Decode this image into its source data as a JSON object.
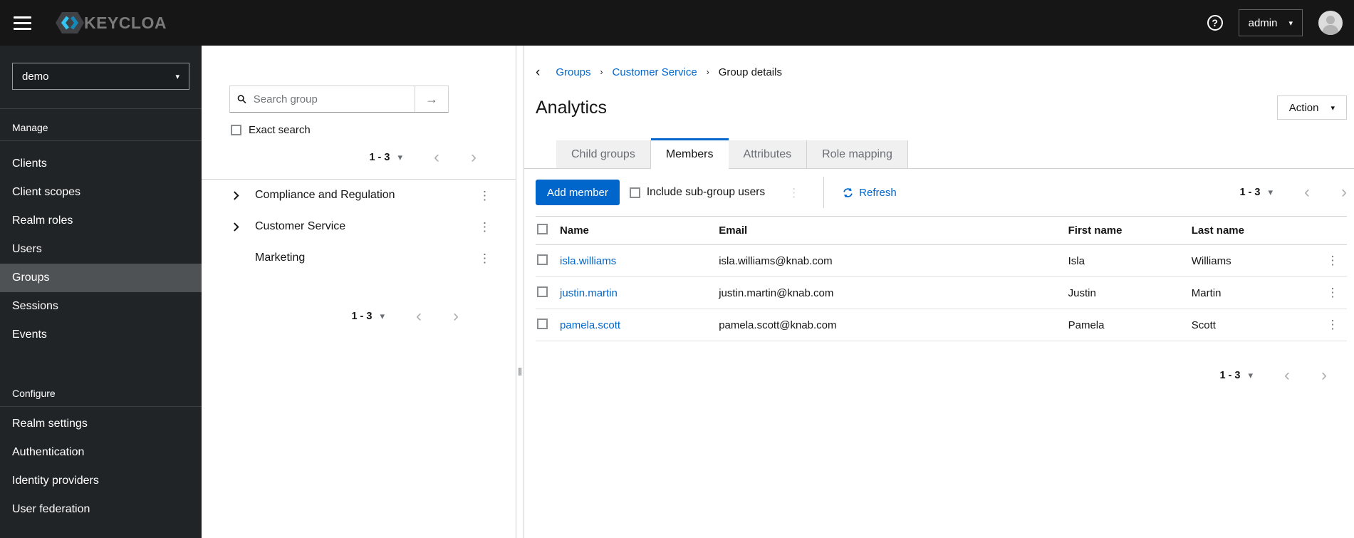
{
  "colors": {
    "accent_blue": "#0066cc",
    "topbar_bg": "#161616",
    "sidebar_bg": "#212427",
    "sidebar_selected_bg": "#4f5255",
    "tab_inactive_bg": "#f0f0f0",
    "link": "#0066cc",
    "logo_cyan": "#33c6f4"
  },
  "glyphs": {
    "caret_down": "▾",
    "chevron_left": "‹",
    "chevron_right": "›",
    "kebab": "⋮",
    "breadcrumb_separator": "›",
    "back_chevron": "‹",
    "search_submit_arrow": "→",
    "help_question": "?",
    "splitter_grip": "‖"
  },
  "topbar": {
    "brand": "KEYCLOAK",
    "username": "admin"
  },
  "sidebar": {
    "realm": "demo",
    "manage": {
      "label": "Manage",
      "items": [
        "Clients",
        "Client scopes",
        "Realm roles",
        "Users",
        "Groups",
        "Sessions",
        "Events"
      ]
    },
    "configure": {
      "label": "Configure",
      "items": [
        "Realm settings",
        "Authentication",
        "Identity providers",
        "User federation"
      ]
    },
    "active_item": "Groups"
  },
  "groups_panel": {
    "search_placeholder": "Search group",
    "exact_search": "Exact search",
    "pager_top": "1 - 3",
    "pager_bottom": "1 - 3",
    "tree": [
      {
        "label": "Compliance and Regulation",
        "expandable": true
      },
      {
        "label": "Customer Service",
        "expandable": true
      },
      {
        "label": "Marketing",
        "expandable": false
      }
    ]
  },
  "main": {
    "breadcrumb": {
      "links": [
        "Groups",
        "Customer Service"
      ],
      "current": "Group details"
    },
    "title": "Analytics",
    "action_button": "Action",
    "tabs": [
      "Child groups",
      "Members",
      "Attributes",
      "Role mapping"
    ],
    "active_tab": "Members",
    "toolbar": {
      "add_member": "Add member",
      "include_subgroups": "Include sub-group users",
      "refresh": "Refresh",
      "pager": "1 - 3"
    },
    "table": {
      "headers": [
        "Name",
        "Email",
        "First name",
        "Last name"
      ],
      "rows": [
        {
          "name": "isla.williams",
          "email": "isla.williams@knab.com",
          "first_name": "Isla",
          "last_name": "Williams"
        },
        {
          "name": "justin.martin",
          "email": "justin.martin@knab.com",
          "first_name": "Justin",
          "last_name": "Martin"
        },
        {
          "name": "pamela.scott",
          "email": "pamela.scott@knab.com",
          "first_name": "Pamela",
          "last_name": "Scott"
        }
      ]
    },
    "pager_bottom": "1 - 3"
  }
}
